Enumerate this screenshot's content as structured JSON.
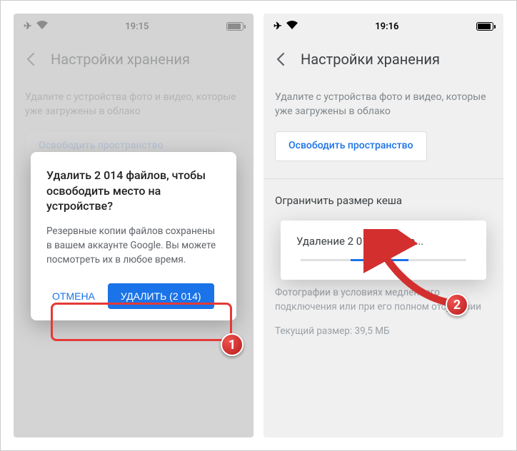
{
  "left": {
    "statusbar": {
      "time": "19:15"
    },
    "header": {
      "title": "Настройки хранения"
    },
    "description": "Удалите с устройства фото и видео, которые уже загружены в облако",
    "freeUpButton": "Освободить пространство",
    "dialog": {
      "title": "Удалить 2 014 файлов, чтобы освободить место на устройстве?",
      "body": "Резервные копии файлов сохранены в вашем аккаунте Google. Вы можете посмотреть их в любое время.",
      "cancel": "ОТМЕНА",
      "confirm": "УДАЛИТЬ (2 014)"
    },
    "badge": "1"
  },
  "right": {
    "statusbar": {
      "time": "19:16"
    },
    "header": {
      "title": "Настройки хранения"
    },
    "description": "Удалите с устройства фото и видео, которые уже загружены в облако",
    "freeUpButton": "Освободить пространство",
    "cacheSection": {
      "title": "Ограничить размер кеша",
      "hint": "Фотографии в условиях медленного подключения или при его полном отсутствии",
      "sizeLabel": "Текущий размер: 39,5 МБ"
    },
    "toast": {
      "text": "Удаление 2 014 файлов..."
    },
    "badge": "2"
  }
}
